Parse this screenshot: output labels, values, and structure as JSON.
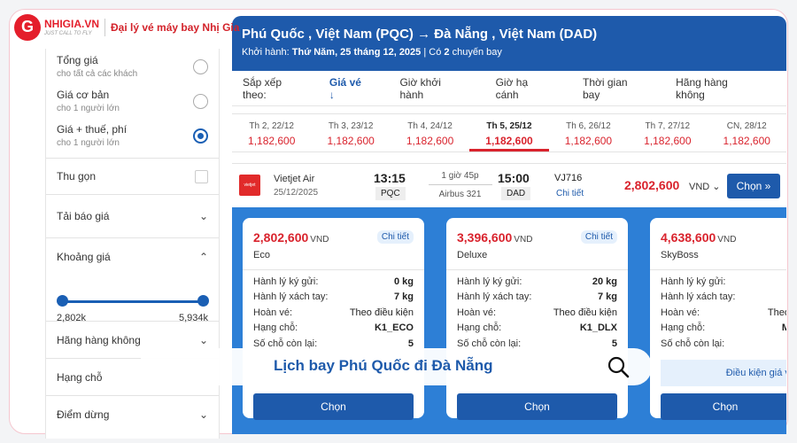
{
  "brand": {
    "name": "NHIGIA.VN",
    "tagline": "JUST CALL TO FLY",
    "slogan": "Đại lý vé máy bay Nhị Gia"
  },
  "sidebar": {
    "price_options": [
      {
        "label": "Tổng giá",
        "sub": "cho tất cả các khách",
        "selected": false
      },
      {
        "label": "Giá cơ bản",
        "sub": "cho 1 người lớn",
        "selected": false
      },
      {
        "label": "Giá + thuế, phí",
        "sub": "cho 1 người lớn",
        "selected": true
      }
    ],
    "collapse_label": "Thu gọn",
    "download_label": "Tải báo giá",
    "range": {
      "label": "Khoảng giá",
      "min_label": "2,802k",
      "max_label": "5,934k",
      "min": 0,
      "max": 1
    },
    "filters": [
      "Hãng hàng không",
      "Hạng chỗ",
      "Điểm dừng"
    ]
  },
  "header": {
    "route": "Phú Quốc , Việt Nam (PQC) → Đà Nẵng , Việt Nam (DAD)",
    "depart_label": "Khởi hành:",
    "depart_date": "Thứ Năm, 25 tháng 12, 2025",
    "count_prefix": "Có",
    "count_value": "2",
    "count_suffix": "chuyến bay"
  },
  "sort": {
    "label": "Sắp xếp theo:",
    "options": [
      "Giá vé ↓",
      "Giờ khởi hành",
      "Giờ hạ cánh",
      "Thời gian bay",
      "Hãng hàng không"
    ]
  },
  "dates": [
    {
      "day": "Th 2, 22/12",
      "price": "1,182,600"
    },
    {
      "day": "Th 3, 23/12",
      "price": "1,182,600"
    },
    {
      "day": "Th 4, 24/12",
      "price": "1,182,600"
    },
    {
      "day": "Th 5, 25/12",
      "price": "1,182,600",
      "active": true
    },
    {
      "day": "Th 6, 26/12",
      "price": "1,182,600"
    },
    {
      "day": "Th 7, 27/12",
      "price": "1,182,600"
    },
    {
      "day": "CN, 28/12",
      "price": "1,182,600"
    }
  ],
  "flight": {
    "airline": "Vietjet Air",
    "date": "25/12/2025",
    "dep_time": "13:15",
    "dep_code": "PQC",
    "duration": "1 giờ 45p",
    "aircraft": "Airbus 321",
    "arr_time": "15:00",
    "arr_code": "DAD",
    "flight_no": "VJ716",
    "detail": "Chi tiết",
    "price": "2,802,600",
    "currency": "VND",
    "choose": "Chọn »"
  },
  "fares": [
    {
      "price": "2,802,600",
      "currency": "VND",
      "class": "Eco",
      "detail": "Chi tiết",
      "rows": [
        {
          "label": "Hành lý ký gửi:",
          "value": "0 kg"
        },
        {
          "label": "Hành lý xách tay:",
          "value": "7 kg"
        },
        {
          "label": "Hoàn vé:",
          "value": "Theo điều kiện"
        },
        {
          "label": "Hạng chỗ:",
          "value": "K1_ECO"
        },
        {
          "label": "Số chỗ còn lại:",
          "value": "5"
        }
      ],
      "button": "Chọn"
    },
    {
      "price": "3,396,600",
      "currency": "VND",
      "class": "Deluxe",
      "detail": "Chi tiết",
      "rows": [
        {
          "label": "Hành lý ký gửi:",
          "value": "20 kg"
        },
        {
          "label": "Hành lý xách tay:",
          "value": "7 kg"
        },
        {
          "label": "Hoàn vé:",
          "value": "Theo điều kiện"
        },
        {
          "label": "Hạng chỗ:",
          "value": "K1_DLX"
        },
        {
          "label": "Số chỗ còn lại:",
          "value": "5"
        }
      ],
      "button": "Chọn"
    },
    {
      "price": "4,638,600",
      "currency": "VND",
      "class": "SkyBoss",
      "rows": [
        {
          "label": "Hành lý ký gửi:",
          "value": ""
        },
        {
          "label": "Hành lý xách tay:",
          "value": ""
        },
        {
          "label": "Hoàn vé:",
          "value": "Theo"
        },
        {
          "label": "Hạng chỗ:",
          "value": "M"
        },
        {
          "label": "Số chỗ còn lại:",
          "value": ""
        }
      ],
      "condition": "Điều kiện giá vé",
      "button": "Chọn"
    }
  ],
  "overlay": {
    "text": "Lịch bay Phú Quốc đi Đà Nẵng"
  }
}
